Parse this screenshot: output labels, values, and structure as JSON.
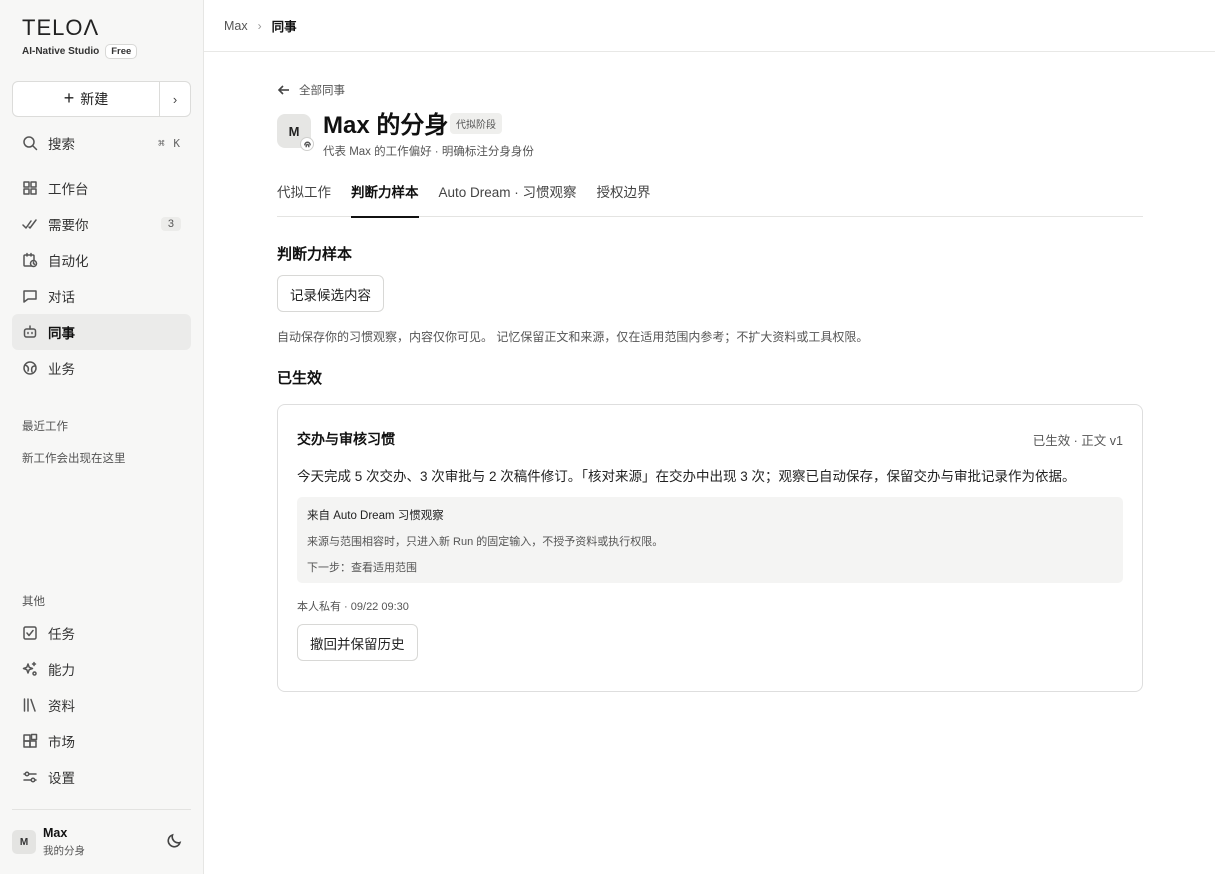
{
  "brand": {
    "logo": "TELOΛ",
    "subtitle": "AI-Native Studio",
    "plan": "Free"
  },
  "sidebar": {
    "new_label": "新建",
    "search": {
      "label": "搜索",
      "shortcut": "⌘ K"
    },
    "items": [
      {
        "label": "工作台",
        "icon": "grid-icon"
      },
      {
        "label": "需要你",
        "icon": "double-check-icon",
        "count": "3"
      },
      {
        "label": "自动化",
        "icon": "calendar-clock-icon"
      },
      {
        "label": "对话",
        "icon": "chat-icon"
      },
      {
        "label": "同事",
        "icon": "bot-icon",
        "active": true
      },
      {
        "label": "业务",
        "icon": "globe-icon"
      }
    ],
    "recent_label": "最近工作",
    "recent_hint": "新工作会出现在这里",
    "other_label": "其他",
    "other_items": [
      {
        "label": "任务",
        "icon": "checkbox-icon"
      },
      {
        "label": "能力",
        "icon": "sparkle-icon"
      },
      {
        "label": "资料",
        "icon": "library-icon"
      },
      {
        "label": "市场",
        "icon": "blocks-icon"
      },
      {
        "label": "设置",
        "icon": "sliders-icon"
      }
    ],
    "user": {
      "initial": "M",
      "name": "Max",
      "sub": "我的分身"
    }
  },
  "breadcrumb": {
    "parent": "Max",
    "current": "同事"
  },
  "profile": {
    "back": "全部同事",
    "initial": "M",
    "title": "Max 的分身",
    "stage": "代拟阶段",
    "desc": "代表 Max 的工作偏好 · 明确标注分身身份"
  },
  "tabs": [
    "代拟工作",
    "判断力样本",
    "Auto Dream · 习惯观察",
    "授权边界"
  ],
  "active_tab": 1,
  "section": {
    "title": "判断力样本",
    "record_button": "记录候选内容",
    "note": "自动保存你的习惯观察，内容仅你可见。 记忆保留正文和来源，仅在适用范围内参考；不扩大资料或工具权限。",
    "effective_title": "已生效"
  },
  "card": {
    "title": "交办与审核习惯",
    "status": "已生效 · 正文 v1",
    "body": "今天完成 5 次交办、3 次审批与 2 次稿件修订。「核对来源」在交办中出现 3 次；观察已自动保存，保留交办与审批记录作为依据。",
    "source_title": "来自 Auto Dream 习惯观察",
    "source_line": "来源与范围相容时，只进入新 Run 的固定输入，不授予资料或执行权限。",
    "next_step": "下一步：查看适用范围",
    "meta": "本人私有 · 09/22 09:30",
    "revoke_button": "撤回并保留历史"
  }
}
